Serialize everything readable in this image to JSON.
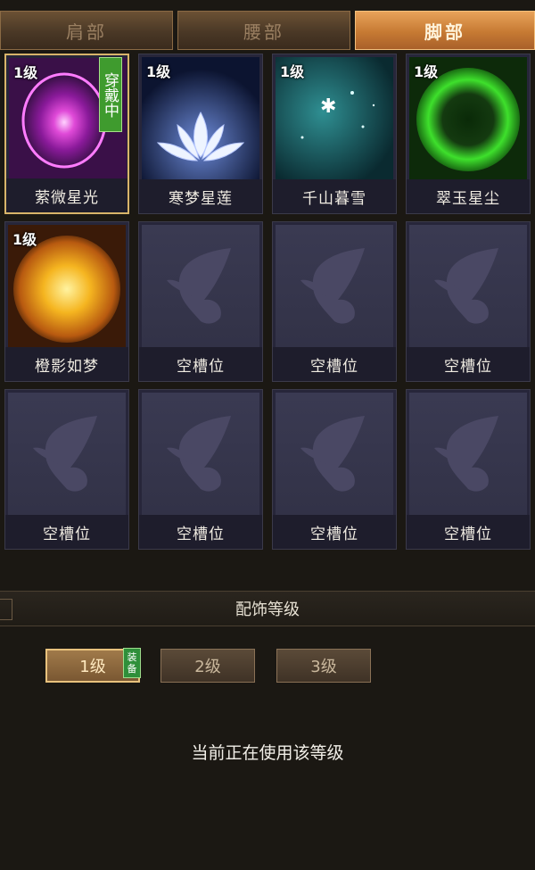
{
  "tabs": [
    {
      "label": "肩部",
      "active": false
    },
    {
      "label": "腰部",
      "active": false
    },
    {
      "label": "脚部",
      "active": true
    }
  ],
  "slots": [
    {
      "level": "1级",
      "name": "萦微星光",
      "art": "purple-orb",
      "worn": "穿戴中",
      "selected": true
    },
    {
      "level": "1级",
      "name": "寒梦星莲",
      "art": "white-lotus"
    },
    {
      "level": "1级",
      "name": "千山暮雪",
      "art": "teal-snowflake"
    },
    {
      "level": "1级",
      "name": "翠玉星尘",
      "art": "green-orb"
    },
    {
      "level": "1级",
      "name": "橙影如梦",
      "art": "orange-sun"
    },
    {
      "name": "空槽位",
      "art": "butterfly-icon"
    },
    {
      "name": "空槽位",
      "art": "butterfly-icon"
    },
    {
      "name": "空槽位",
      "art": "butterfly-icon"
    },
    {
      "name": "空槽位",
      "art": "butterfly-icon"
    },
    {
      "name": "空槽位",
      "art": "butterfly-icon"
    },
    {
      "name": "空槽位",
      "art": "butterfly-icon"
    },
    {
      "name": "空槽位",
      "art": "butterfly-icon"
    }
  ],
  "section": {
    "title": "配饰等级"
  },
  "levels": [
    {
      "label": "1级",
      "active": true
    },
    {
      "label": "2级",
      "active": false
    },
    {
      "label": "3级",
      "active": false
    }
  ],
  "equip_badge": "装备",
  "status": "当前正在使用该等级"
}
